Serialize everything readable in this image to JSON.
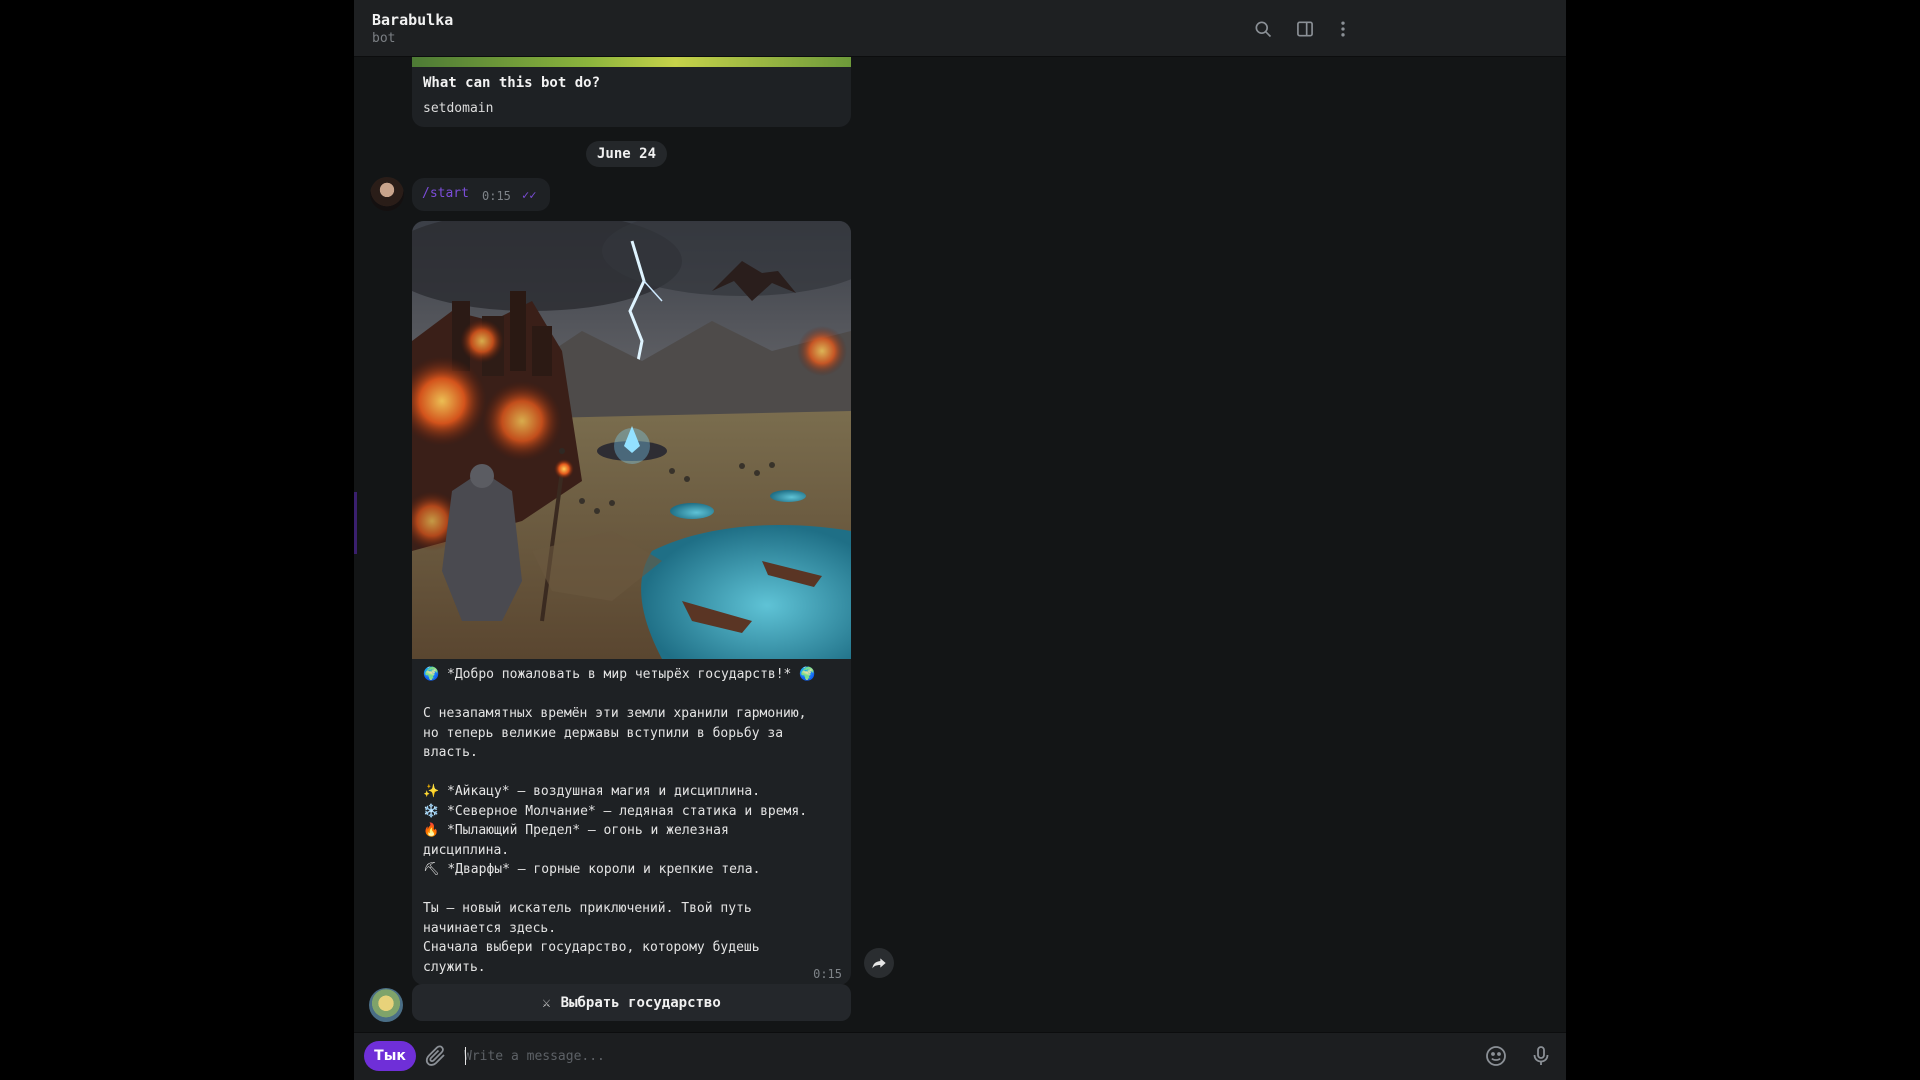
{
  "header": {
    "title": "Barabulka",
    "subtitle": "bot",
    "icons": [
      "search-icon",
      "sidebar-toggle-icon",
      "more-vertical-icon"
    ]
  },
  "info_card": {
    "question": "What can this bot do?",
    "answer": "setdomain"
  },
  "date_separator": "June 24",
  "user_message": {
    "text": "/start",
    "time": "0:15"
  },
  "bot_message": {
    "image_icon": "fantasy-world-image",
    "lines": [
      "🌍 *Добро пожаловать в мир четырёх государств!* 🌍",
      "",
      "С незапамятных времён эти земли хранили гармонию,",
      "но теперь великие державы вступили в борьбу за",
      "власть.",
      "",
      "✨ *Айкацу* — воздушная магия и дисциплина.",
      "❄️ *Северное Молчание* — ледяная статика и время.",
      "🔥 *Пылающий Предел* — огонь и железная",
      "дисциплина.",
      "⛏ *Дварфы* — горные короли и крепкие тела.",
      "",
      "Ты — новый искатель приключений. Твой путь",
      "начинается здесь.",
      "Сначала выбери государство, которому будешь",
      "служить."
    ],
    "time": "0:15"
  },
  "inline_button": {
    "icon": "crossed-swords-icon",
    "label": "Выбрать государство"
  },
  "composer": {
    "menu_label": "Тык",
    "placeholder": "Write a message...",
    "value": ""
  }
}
